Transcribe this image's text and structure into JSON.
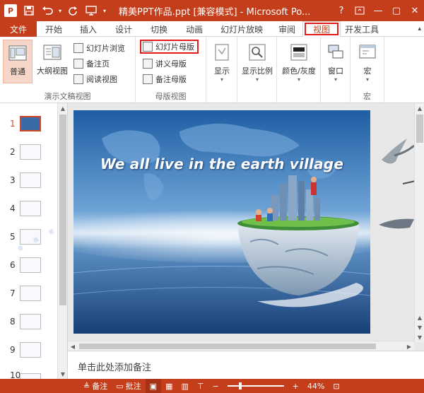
{
  "window": {
    "app_badge": "P",
    "title": "精美PPT作品.ppt [兼容模式] - Microsoft Po...",
    "help": "?",
    "minimize": "—",
    "restore": "▢",
    "close": "✕"
  },
  "quick_access": {
    "save_icon": "save-icon",
    "undo_icon": "undo-icon",
    "redo_icon": "redo-icon",
    "present_icon": "present-icon"
  },
  "tabs": [
    "文件",
    "开始",
    "插入",
    "设计",
    "切换",
    "动画",
    "幻灯片放映",
    "审阅",
    "视图",
    "开发工具"
  ],
  "active_tab": "视图",
  "ribbon": {
    "groups": {
      "presentation_views": "演示文稿视图",
      "master_views": "母版视图",
      "macro": "宏"
    },
    "normal": "普通",
    "outline": "大纲视图",
    "slide_sorter": "幻灯片浏览",
    "notes_page": "备注页",
    "reading_view": "阅读视图",
    "slide_master": "幻灯片母版",
    "handout_master": "讲义母版",
    "notes_master": "备注母版",
    "show": "显示",
    "zoom": "显示比例",
    "color_grayscale": "颜色/灰度",
    "window": "窗口",
    "macros": "宏"
  },
  "thumbnails": {
    "numbers": [
      "1",
      "2",
      "3",
      "4",
      "5",
      "6",
      "7",
      "8",
      "9",
      "10"
    ],
    "selected": "1"
  },
  "slide": {
    "title": "We all live in the earth village"
  },
  "notes": {
    "placeholder": "单击此处添加备注"
  },
  "status": {
    "notes": "备注",
    "comments": "批注",
    "zoom": "44%",
    "zoom_level": 0.44
  },
  "colors": {
    "accent": "#c43e1c",
    "highlight_box": "#e01b1b",
    "pressed": "#f6d6c9"
  }
}
